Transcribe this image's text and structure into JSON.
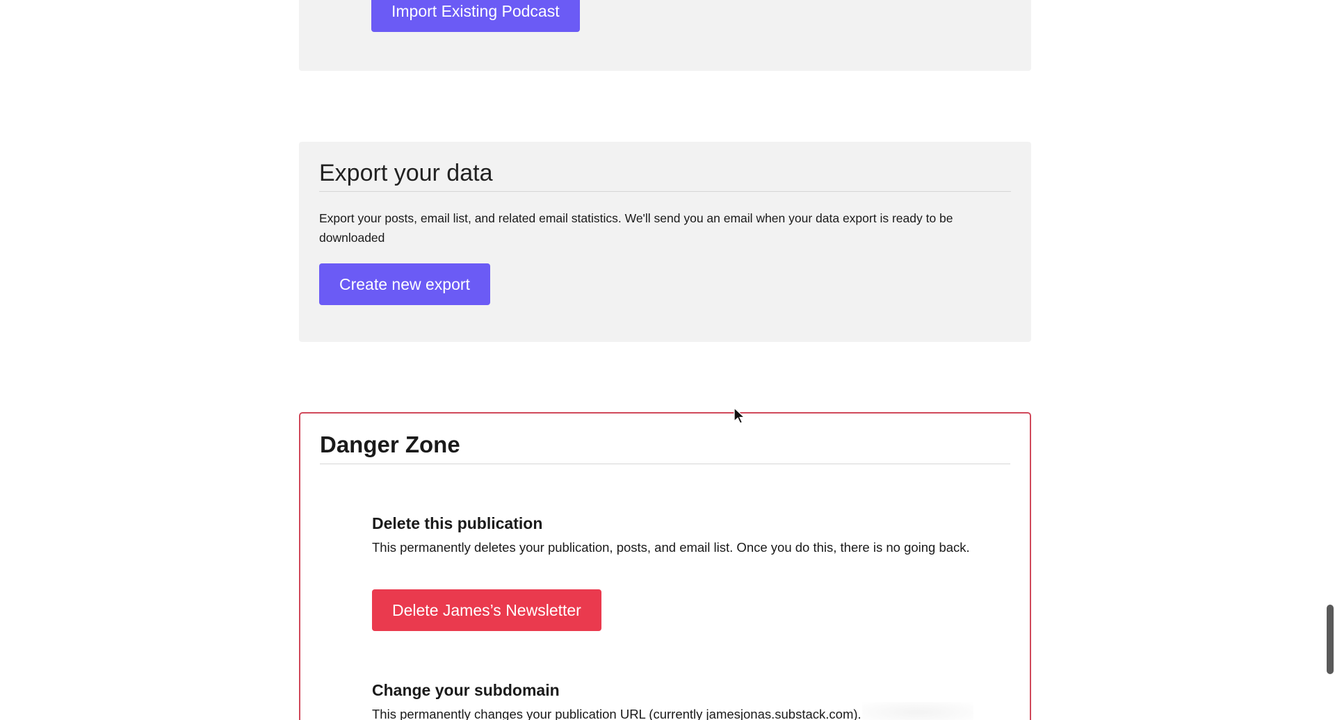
{
  "podcast": {
    "import_label": "Import Existing Podcast"
  },
  "export": {
    "title": "Export your data",
    "description": "Export your posts, email list, and related email statistics. We'll send you an email when your data export is ready to be downloaded",
    "button_label": "Create new export"
  },
  "danger": {
    "title": "Danger Zone",
    "delete": {
      "title": "Delete this publication",
      "description": "This permanently deletes your publication, posts, and email list. Once you do this, there is no going back.",
      "button_label": "Delete James’s Newsletter"
    },
    "subdomain": {
      "title": "Change your subdomain",
      "description": "This permanently changes your publication URL (currently jamesjonas.substack.com)."
    }
  },
  "colors": {
    "primary": "#6b5bf5",
    "danger": "#ea3a4e",
    "card_bg": "#f2f2f2",
    "danger_border": "#d0485a"
  }
}
